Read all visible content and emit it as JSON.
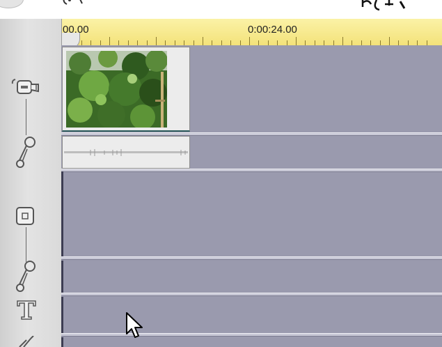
{
  "ruler": {
    "start_label": "00.00",
    "mid_label": "0:00:24.00"
  },
  "tracks": [
    {
      "name": "video-track",
      "icon": "camcorder-icon"
    },
    {
      "name": "audio-track-1",
      "icon": "audio-adjust-icon"
    },
    {
      "name": "overlay-track",
      "icon": "overlay-square-icon"
    },
    {
      "name": "audio-track-2",
      "icon": "audio-adjust-icon"
    },
    {
      "name": "title-track",
      "icon": "text-T-icon"
    },
    {
      "name": "music-track",
      "icon": "music-note-icon"
    }
  ],
  "colors": {
    "track_bg": "#9a9aae",
    "ruler_bg": "#f3e27a",
    "sidebar_bg": "#d9d9d9",
    "clip_bg": "#ececec"
  }
}
